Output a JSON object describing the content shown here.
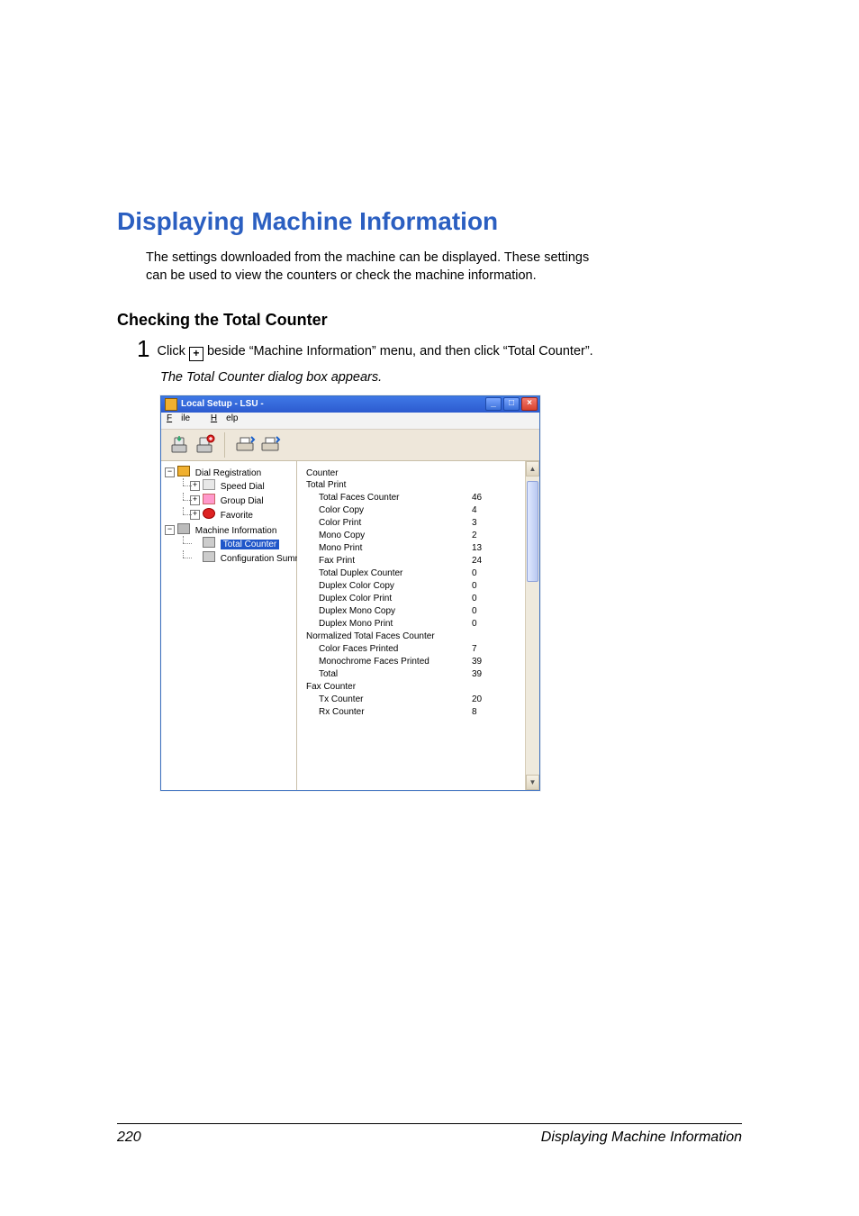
{
  "title": "Displaying Machine Information",
  "intro_line1": "The settings downloaded from the machine can be displayed. These settings",
  "intro_line2": "can be used to view the counters or check the machine information.",
  "subhead": "Checking the Total Counter",
  "step_number": "1",
  "step_text_a": "Click ",
  "step_plus": "+",
  "step_text_b": " beside “Machine Information” menu, and then click “Total Counter”.",
  "caption": "The Total Counter dialog box appears.",
  "window": {
    "title": "Local Setup - LSU -",
    "menu": {
      "file": "File",
      "help": "Help"
    },
    "tree": {
      "root": "Dial Registration",
      "speed": "Speed Dial",
      "group": "Group Dial",
      "favorite": "Favorite",
      "machine": "Machine Information",
      "total": "Total Counter",
      "config": "Configuration Summary"
    },
    "content": {
      "header": "Counter",
      "total_print": "Total Print",
      "rows_print": [
        {
          "k": "Total Faces Counter",
          "v": "46"
        },
        {
          "k": "Color Copy",
          "v": "4"
        },
        {
          "k": "Color Print",
          "v": "3"
        },
        {
          "k": "Mono Copy",
          "v": "2"
        },
        {
          "k": "Mono Print",
          "v": "13"
        },
        {
          "k": "Fax Print",
          "v": "24"
        },
        {
          "k": "Total Duplex Counter",
          "v": "0"
        },
        {
          "k": "Duplex Color Copy",
          "v": "0"
        },
        {
          "k": "Duplex Color Print",
          "v": "0"
        },
        {
          "k": "Duplex Mono Copy",
          "v": "0"
        },
        {
          "k": "Duplex Mono Print",
          "v": "0"
        }
      ],
      "normalized_header": "Normalized Total Faces Counter",
      "rows_norm": [
        {
          "k": "Color Faces Printed",
          "v": "7"
        },
        {
          "k": "Monochrome Faces Printed",
          "v": "39"
        },
        {
          "k": "Total",
          "v": "39"
        }
      ],
      "fax_header": "Fax Counter",
      "rows_fax": [
        {
          "k": "Tx Counter",
          "v": "20"
        },
        {
          "k": "Rx Counter",
          "v": "8"
        }
      ]
    }
  },
  "footer": {
    "page": "220",
    "section": "Displaying Machine Information"
  }
}
